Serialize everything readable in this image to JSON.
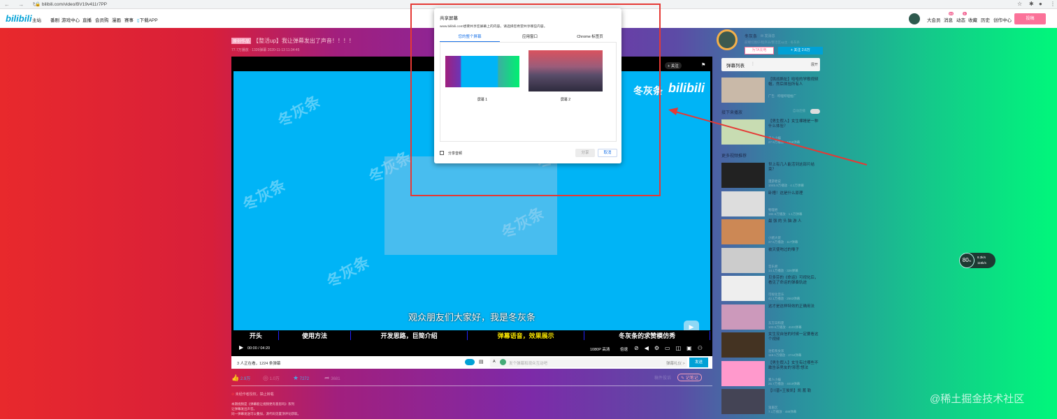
{
  "browser": {
    "url": "bilibili.com/video/BV19v411r7PP"
  },
  "nav": {
    "logo": "bilibili",
    "items": [
      "主站",
      "番剧",
      "游戏中心",
      "直播",
      "会员购",
      "漫画",
      "赛事",
      "下载APP"
    ],
    "right": [
      "大会员",
      "消息",
      "动态",
      "收藏",
      "历史",
      "创作中心"
    ],
    "badges": {
      "message": "60",
      "dynamic": "5"
    },
    "upload": "投稿"
  },
  "video": {
    "tag": "原创作品",
    "title": "【整活up】我让弹幕发出了声音！！！！",
    "meta": "77.7万播放 · 1326弹幕   2020-11-13 11:34:45",
    "follow_chip": "+ 关注",
    "brand": "bilibili",
    "watermark": "冬灰条",
    "subtitle": "观众朋友们大家好，我是冬灰条",
    "chapters": [
      "开头",
      "使用方法",
      "开发思路，巨简介绍",
      "弹幕语音，效果展示",
      "冬灰条的求赞模仿秀"
    ],
    "time": "00:00 / 04:20",
    "quality": "1080P 高清",
    "speed": "倍速",
    "viewers": "3 人正在看，1224 条弹幕",
    "dm_placeholder": "发个弹幕和观众互动吧",
    "dm_etiquette": "弹幕礼仪 >",
    "dm_send": "发送"
  },
  "actions": {
    "like": "2.9万",
    "coin": "1.0万",
    "fav": "7272",
    "share": "3681",
    "report": "稿件投诉",
    "note": "记笔记"
  },
  "desc": {
    "notice": "未经作者授权，禁止转载",
    "lines": [
      "本期视频是《弹幕能让视频更有意思吗》系列",
      "让弹幕发出声音。",
      "同一弹幕发送可以叠加，源代码见置顶评论获取。"
    ]
  },
  "uploader": {
    "name": "冬灰条",
    "msg": "发消息",
    "bio": "前端切图仔/程序员/整活区up主 · 冬灰条",
    "charge": "为TA充电",
    "follow": "+ 关注 2.6万"
  },
  "danmaku_list": {
    "title": "弹幕列表",
    "expand": "展开"
  },
  "ad": {
    "title": "【挑战撕扯】哈哈的学歌视频帽，然后体验所有人",
    "sub": "广告 · 哔哩哔哩推广"
  },
  "autoplay": {
    "label": "接下来播放",
    "toggle": "自动连播"
  },
  "next": {
    "title": "【男生假入】女生裸睡是一种什么体验？",
    "up": "素人小编",
    "stats": "27.9万播放 · 1659弹幕"
  },
  "more_title": "更多视频推荐",
  "recs": [
    {
      "title": "世上有几人能活到这部片结束？",
      "up": "漫游者说",
      "stats": "1045.9万播放 · 4.1万弹幕"
    },
    {
      "title": "卧槽！这是什么原理",
      "up": "物理君",
      "stats": "184.6万播放 · 1.1万弹幕"
    },
    {
      "title": "最 强 的 头 脑 游 人",
      "up": "小猪大佬",
      "stats": "37.5万播放 · 117弹幕"
    },
    {
      "title": "被天使吻过的嗓子",
      "up": "音乐君",
      "stats": "14.1万播放 · 326弹幕"
    },
    {
      "title": "贝多芬的《命运》可视化后，看见了命运的弹奏轨迹",
      "up": "可视化音乐",
      "stats": "42.1万播放 · 2563弹幕"
    },
    {
      "title": "这才是这样特效的正确用法",
      "up": "东方日和夏",
      "stats": "103.5万播放 · 4103弹幕"
    },
    {
      "title": "女生没自信的时候一定要看这个视频",
      "up": "治愈系女孩",
      "stats": "119.1万播放 · 2744弹幕"
    },
    {
      "title": "【男生假入】女生有过哪些不敢告诉男友的'邪恶'想法",
      "up": "素人小编",
      "stats": "25.7万播放 · 4019弹幕"
    },
    {
      "title": "【川普×王俊凯】凯 蓄 勒",
      "up": "鬼畜区",
      "stats": "7.1万播放 · 488弹幕"
    }
  ],
  "net_widget": {
    "percent": "80",
    "up": "8.3k/s",
    "down": "116k/s"
  },
  "dialog": {
    "title": "共享屏幕",
    "desc": "www.bilibili.com想要共享您屏幕上的内容。请选择您希望共享哪些内容。",
    "tabs": [
      "您的整个屏幕",
      "应用窗口",
      "Chrome 标签页"
    ],
    "screens": [
      "屏幕 1",
      "屏幕 2"
    ],
    "share_audio": "分享音频",
    "share": "分享",
    "cancel": "取消"
  },
  "watermark": "@稀土掘金技术社区",
  "colors": {
    "bili_blue": "#00a1d6",
    "pink": "#fb7299",
    "annotation_red": "#e53935"
  }
}
